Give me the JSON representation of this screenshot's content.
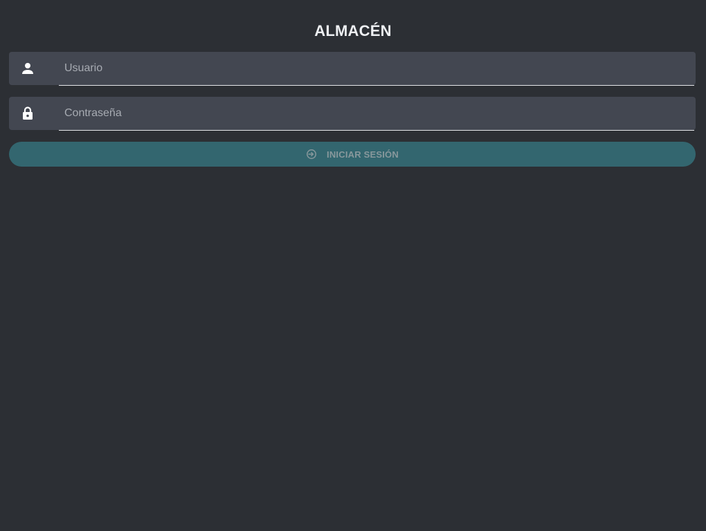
{
  "header": {
    "title": "ALMACÉN"
  },
  "form": {
    "username": {
      "placeholder": "Usuario",
      "value": "",
      "icon": "person-icon"
    },
    "password": {
      "placeholder": "Contraseña",
      "value": "",
      "icon": "lock-icon"
    },
    "submit": {
      "label": "INICIAR SESIÓN",
      "icon": "login-icon",
      "enabled": false
    }
  },
  "colors": {
    "background": "#2c2f34",
    "field_background": "#434751",
    "button_background": "#33666f",
    "button_text": "#88989c",
    "title_text": "#eef0f3"
  }
}
